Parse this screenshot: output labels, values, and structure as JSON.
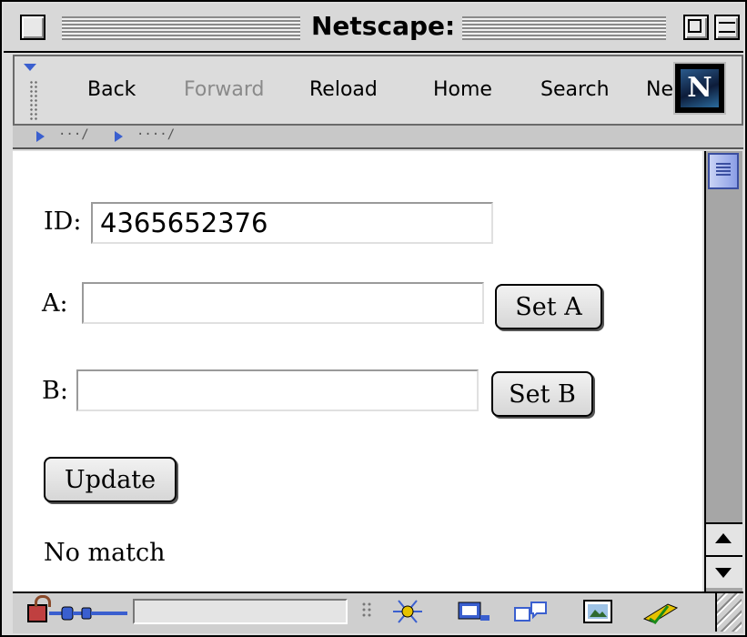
{
  "window": {
    "title": "Netscape:"
  },
  "toolbar": {
    "buttons": [
      {
        "label": "Back",
        "enabled": true
      },
      {
        "label": "Forward",
        "enabled": false
      },
      {
        "label": "Reload",
        "enabled": true
      },
      {
        "label": "Home",
        "enabled": true
      },
      {
        "label": "Search",
        "enabled": true
      },
      {
        "label": "Ne",
        "enabled": true
      }
    ],
    "logo_letter": "N"
  },
  "form": {
    "id_label": "ID:",
    "id_value": "4365652376",
    "a_label": "A:",
    "a_value": "",
    "set_a_label": "Set A",
    "b_label": "B:",
    "b_value": "",
    "set_b_label": "Set B",
    "update_label": "Update",
    "status_text": "No match"
  },
  "colors": {
    "accent_blue": "#3a5fcf",
    "scroll_thumb": "#8b9ee6"
  },
  "icons": [
    "lock-icon",
    "plug-icon",
    "resize-grip-icon",
    "collapse-arrow-icon"
  ]
}
